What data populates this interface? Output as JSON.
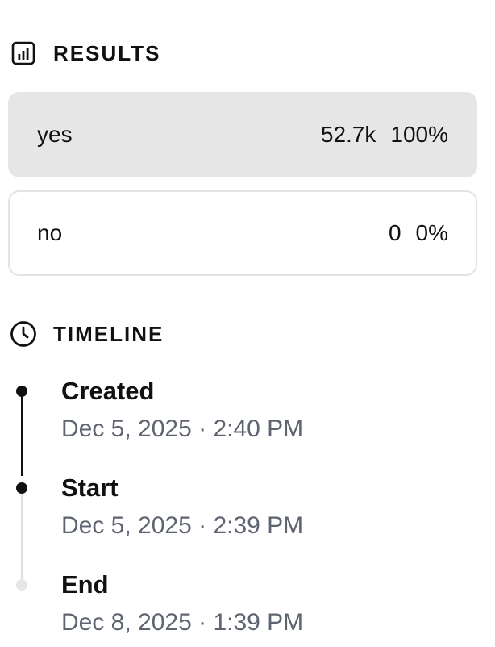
{
  "results": {
    "title": "RESULTS",
    "icon": "bar-chart-icon",
    "options": [
      {
        "label": "yes",
        "count": "52.7k",
        "percent": "100%",
        "selected": true
      },
      {
        "label": "no",
        "count": "0",
        "percent": "0%",
        "selected": false
      }
    ]
  },
  "timeline": {
    "title": "TIMELINE",
    "icon": "clock-icon",
    "events": [
      {
        "label": "Created",
        "date": "Dec 5, 2025 · 2:40 PM",
        "state": "done"
      },
      {
        "label": "Start",
        "date": "Dec 5, 2025 · 2:39 PM",
        "state": "done"
      },
      {
        "label": "End",
        "date": "Dec 8, 2025 · 1:39 PM",
        "state": "pending"
      }
    ]
  },
  "colors": {
    "selected_bg": "#e6e6e6",
    "border": "#e3e3e3",
    "text": "#111111",
    "muted_text": "#5e6470",
    "pending_dot": "#e6e6e6"
  }
}
